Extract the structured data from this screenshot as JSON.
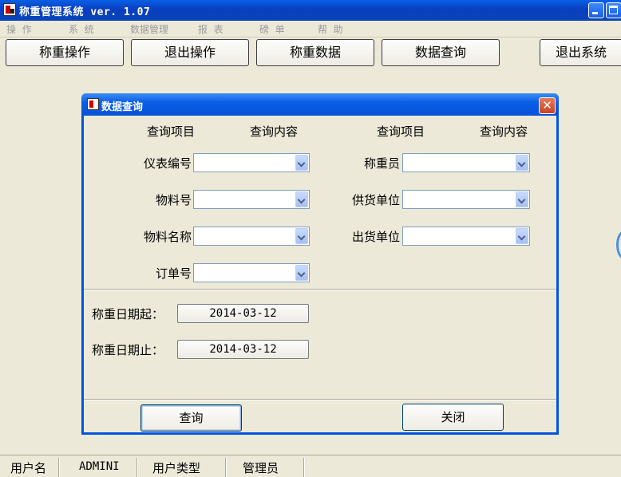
{
  "window": {
    "title": "称重管理系统 ver. 1.07"
  },
  "menu": [
    {
      "label": "操  作"
    },
    {
      "label": "系  统"
    },
    {
      "label": "数据管理"
    },
    {
      "label": "报  表"
    },
    {
      "label": "磅  单"
    },
    {
      "label": "帮  助"
    }
  ],
  "toolbar": [
    {
      "label": "称重操作"
    },
    {
      "label": "退出操作"
    },
    {
      "label": "称重数据"
    },
    {
      "label": "数据查询"
    },
    {
      "label": "退出系统"
    }
  ],
  "dialog": {
    "title": "数据查询",
    "close_glyph": "✕",
    "headers": {
      "item_left": "查询项目",
      "content_left": "查询内容",
      "item_right": "查询项目",
      "content_right": "查询内容"
    },
    "fields": {
      "meter_no": {
        "label": "仪表编号",
        "value": ""
      },
      "weigher": {
        "label": "称重员",
        "value": ""
      },
      "material_no": {
        "label": "物料号",
        "value": ""
      },
      "supplier": {
        "label": "供货单位",
        "value": ""
      },
      "material_name": {
        "label": "物料名称",
        "value": ""
      },
      "shipper": {
        "label": "出货单位",
        "value": ""
      },
      "order_no": {
        "label": "订单号",
        "value": ""
      }
    },
    "date_from": {
      "label": "称重日期起：",
      "value": "2014-03-12"
    },
    "date_to": {
      "label": "称重日期止：",
      "value": "2014-03-12"
    },
    "query_button": "查询",
    "close_button": "关闭"
  },
  "statusbar": {
    "user_label": "用户名",
    "user_value": "ADMINI",
    "type_label": "用户类型",
    "type_value": "管理员"
  }
}
